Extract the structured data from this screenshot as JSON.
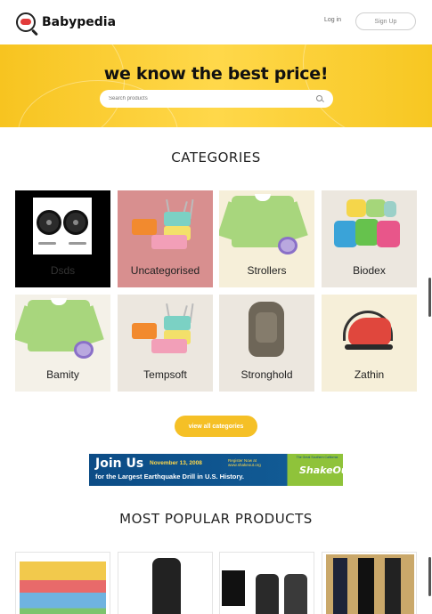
{
  "header": {
    "brand": "Babypedia",
    "login_label": "Log in",
    "signup_label": "Sign Up"
  },
  "hero": {
    "title": "we know the best price!",
    "search_placeholder": "Search products"
  },
  "categories": {
    "title": "CATEGORIES",
    "items": [
      {
        "label": "Dsds",
        "bg": "#000000",
        "label_color": "#333333"
      },
      {
        "label": "Uncategorised",
        "bg": "#d88f8f",
        "label_color": "#222222"
      },
      {
        "label": "Strollers",
        "bg": "#f6efd9",
        "label_color": "#222222"
      },
      {
        "label": "Biodex",
        "bg": "#ece7df",
        "label_color": "#222222"
      },
      {
        "label": "Bamity",
        "bg": "#f4f1e8",
        "label_color": "#222222"
      },
      {
        "label": "Tempsoft",
        "bg": "#ece7df",
        "label_color": "#222222"
      },
      {
        "label": "Stronghold",
        "bg": "#ece7df",
        "label_color": "#222222"
      },
      {
        "label": "Zathin",
        "bg": "#f6efd9",
        "label_color": "#222222"
      }
    ],
    "view_all_label": "view all categories"
  },
  "banner": {
    "headline": "Join Us",
    "date": "November 13, 2008",
    "register": "Register Now at www.shakeout.org",
    "subline": "for the Largest Earthquake Drill in U.S. History.",
    "tag": "The Great Southern California",
    "logo": "ShakeOut"
  },
  "popular": {
    "title": "MOST POPULAR PRODUCTS"
  },
  "colors": {
    "accent": "#f5c026",
    "hero_yellow": "#ffd84a"
  }
}
